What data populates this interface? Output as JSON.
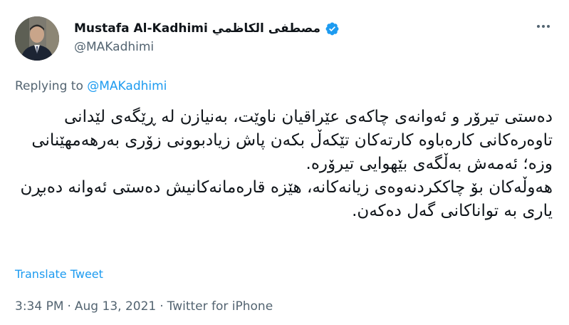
{
  "tweet": {
    "author_name": "Mustafa Al-Kadhimi مصطفى الكاظمي",
    "handle": "@MAKadhimi",
    "replying_prefix": "Replying to",
    "replying_mention": "@MAKadhimi",
    "body_paragraphs": [
      "دەستی تیرۆر و ئەوانەی چاکەی عێراقیان ناوێت، بەنیازن لە ڕێگەی لێدانی تاوەرەکانی کارەباوە کارتەکان تێکەڵ بکەن پاش زیادبوونی زۆری بەرهەمهێنانی وزە؛ ئەمەش بەڵگەی بێهوایی تیرۆرە.",
      "هەوڵەکان بۆ چاککردنەوەی زیانەکانە، هێزە قارەمانەکانیش دەستی ئەوانە دەبڕن یاری بە تواناکانی گەل دەکەن."
    ],
    "translate_label": "Translate Tweet",
    "time": "3:34 PM",
    "date": "Aug 13, 2021",
    "source": "Twitter for iPhone",
    "separator": "·",
    "accent_color": "#1d9bf0",
    "icons": [
      "verified-badge-icon",
      "more-options-icon"
    ]
  }
}
